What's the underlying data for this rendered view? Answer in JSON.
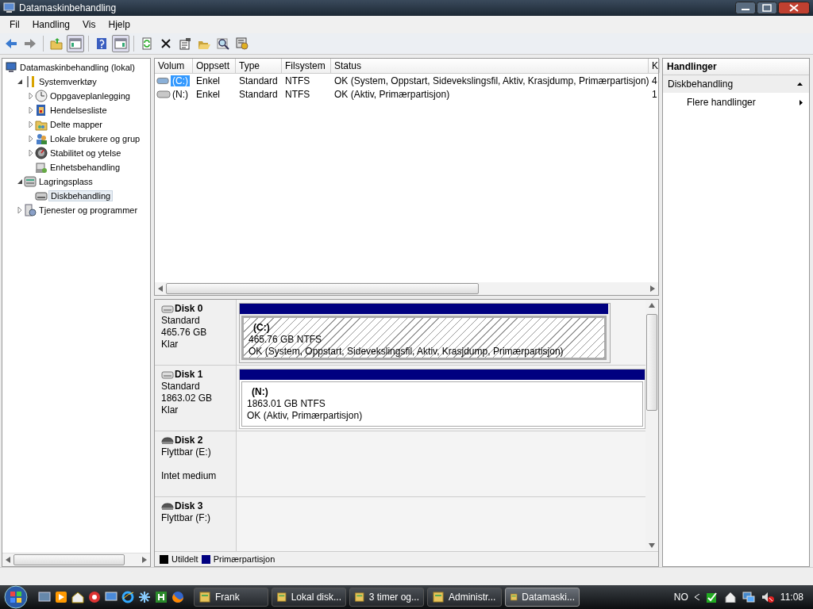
{
  "window": {
    "title": "Datamaskinbehandling"
  },
  "menu": [
    "Fil",
    "Handling",
    "Vis",
    "Hjelp"
  ],
  "toolbar": [
    {
      "kind": "back"
    },
    {
      "kind": "forward"
    },
    {
      "kind": "sep"
    },
    {
      "kind": "up"
    },
    {
      "kind": "pane-left",
      "selected": true
    },
    {
      "kind": "sep"
    },
    {
      "kind": "help"
    },
    {
      "kind": "pane-right",
      "selected": true
    },
    {
      "kind": "sep"
    },
    {
      "kind": "refresh"
    },
    {
      "kind": "delete"
    },
    {
      "kind": "properties"
    },
    {
      "kind": "open"
    },
    {
      "kind": "search"
    },
    {
      "kind": "settings"
    }
  ],
  "tree": [
    {
      "label": "Datamaskinbehandling (lokal)",
      "selected": false,
      "children": [
        {
          "label": "Systemverktøy",
          "expanded": true,
          "selected": false,
          "children": [
            {
              "label": "Oppgaveplanlegging",
              "expanded": false,
              "selected": false
            },
            {
              "label": "Hendelsesliste",
              "expanded": false,
              "selected": false
            },
            {
              "label": "Delte mapper",
              "expanded": false,
              "selected": false
            },
            {
              "label": "Lokale brukere og grup",
              "expanded": false,
              "selected": false
            },
            {
              "label": "Stabilitet og ytelse",
              "expanded": false,
              "selected": false
            },
            {
              "label": "Enhetsbehandling",
              "selected": false
            }
          ]
        },
        {
          "label": "Lagringsplass",
          "expanded": true,
          "selected": false,
          "children": [
            {
              "label": "Diskbehandling",
              "selected": true
            }
          ]
        },
        {
          "label": "Tjenester og programmer",
          "expanded": false,
          "selected": false
        }
      ]
    }
  ],
  "volumes": {
    "columns": [
      "Volum",
      "Oppsett",
      "Type",
      "Filsystem",
      "Status",
      "K"
    ],
    "rows": [
      {
        "cells": [
          "(C:)",
          "Enkel",
          "Standard",
          "NTFS",
          "OK (System, Oppstart, Sidevekslingsfil, Aktiv, Krasjdump, Primærpartisjon)",
          "4"
        ],
        "selected": true
      },
      {
        "cells": [
          "(N:)",
          "Enkel",
          "Standard",
          "NTFS",
          "OK (Aktiv, Primærpartisjon)",
          "1"
        ],
        "selected": false
      }
    ]
  },
  "disks": [
    {
      "name": "Disk 0",
      "kind": "fixed",
      "type": "Standard",
      "size": "465.76 GB",
      "status": "Klar",
      "partitions": [
        {
          "label": "(C:)",
          "size": "465.76 GB NTFS",
          "status": "OK (System, Oppstart, Sidevekslingsfil, Aktiv, Krasjdump, Primærpartisjon)",
          "color": "#000080",
          "selected": true
        }
      ]
    },
    {
      "name": "Disk 1",
      "kind": "fixed",
      "type": "Standard",
      "size": "1863.02 GB",
      "status": "Klar",
      "partitions": [
        {
          "label": "(N:)",
          "size": "1863.01 GB NTFS",
          "status": "OK (Aktiv, Primærpartisjon)",
          "color": "#000080",
          "selected": false
        }
      ]
    },
    {
      "name": "Disk 2",
      "kind": "removable",
      "type": "Flyttbar (E:)",
      "status": "Intet medium"
    },
    {
      "name": "Disk 3",
      "kind": "removable",
      "type": "Flyttbar (F:)"
    }
  ],
  "legend": [
    {
      "label": "Utildelt",
      "color": "#000000"
    },
    {
      "label": "Primærpartisjon",
      "color": "#000080"
    }
  ],
  "actions": {
    "title": "Handlinger",
    "section": "Diskbehandling",
    "expanded": true,
    "items": [
      "Flere handlinger"
    ]
  },
  "taskbar": {
    "tasks": [
      {
        "label": "Frank",
        "selected": false
      },
      {
        "label": "Lokal disk...",
        "selected": false
      },
      {
        "label": "3 timer og...",
        "selected": false
      },
      {
        "label": "Administr...",
        "selected": false
      },
      {
        "label": "Datamaski...",
        "selected": true
      }
    ],
    "language": "NO",
    "clock": "11:08"
  }
}
